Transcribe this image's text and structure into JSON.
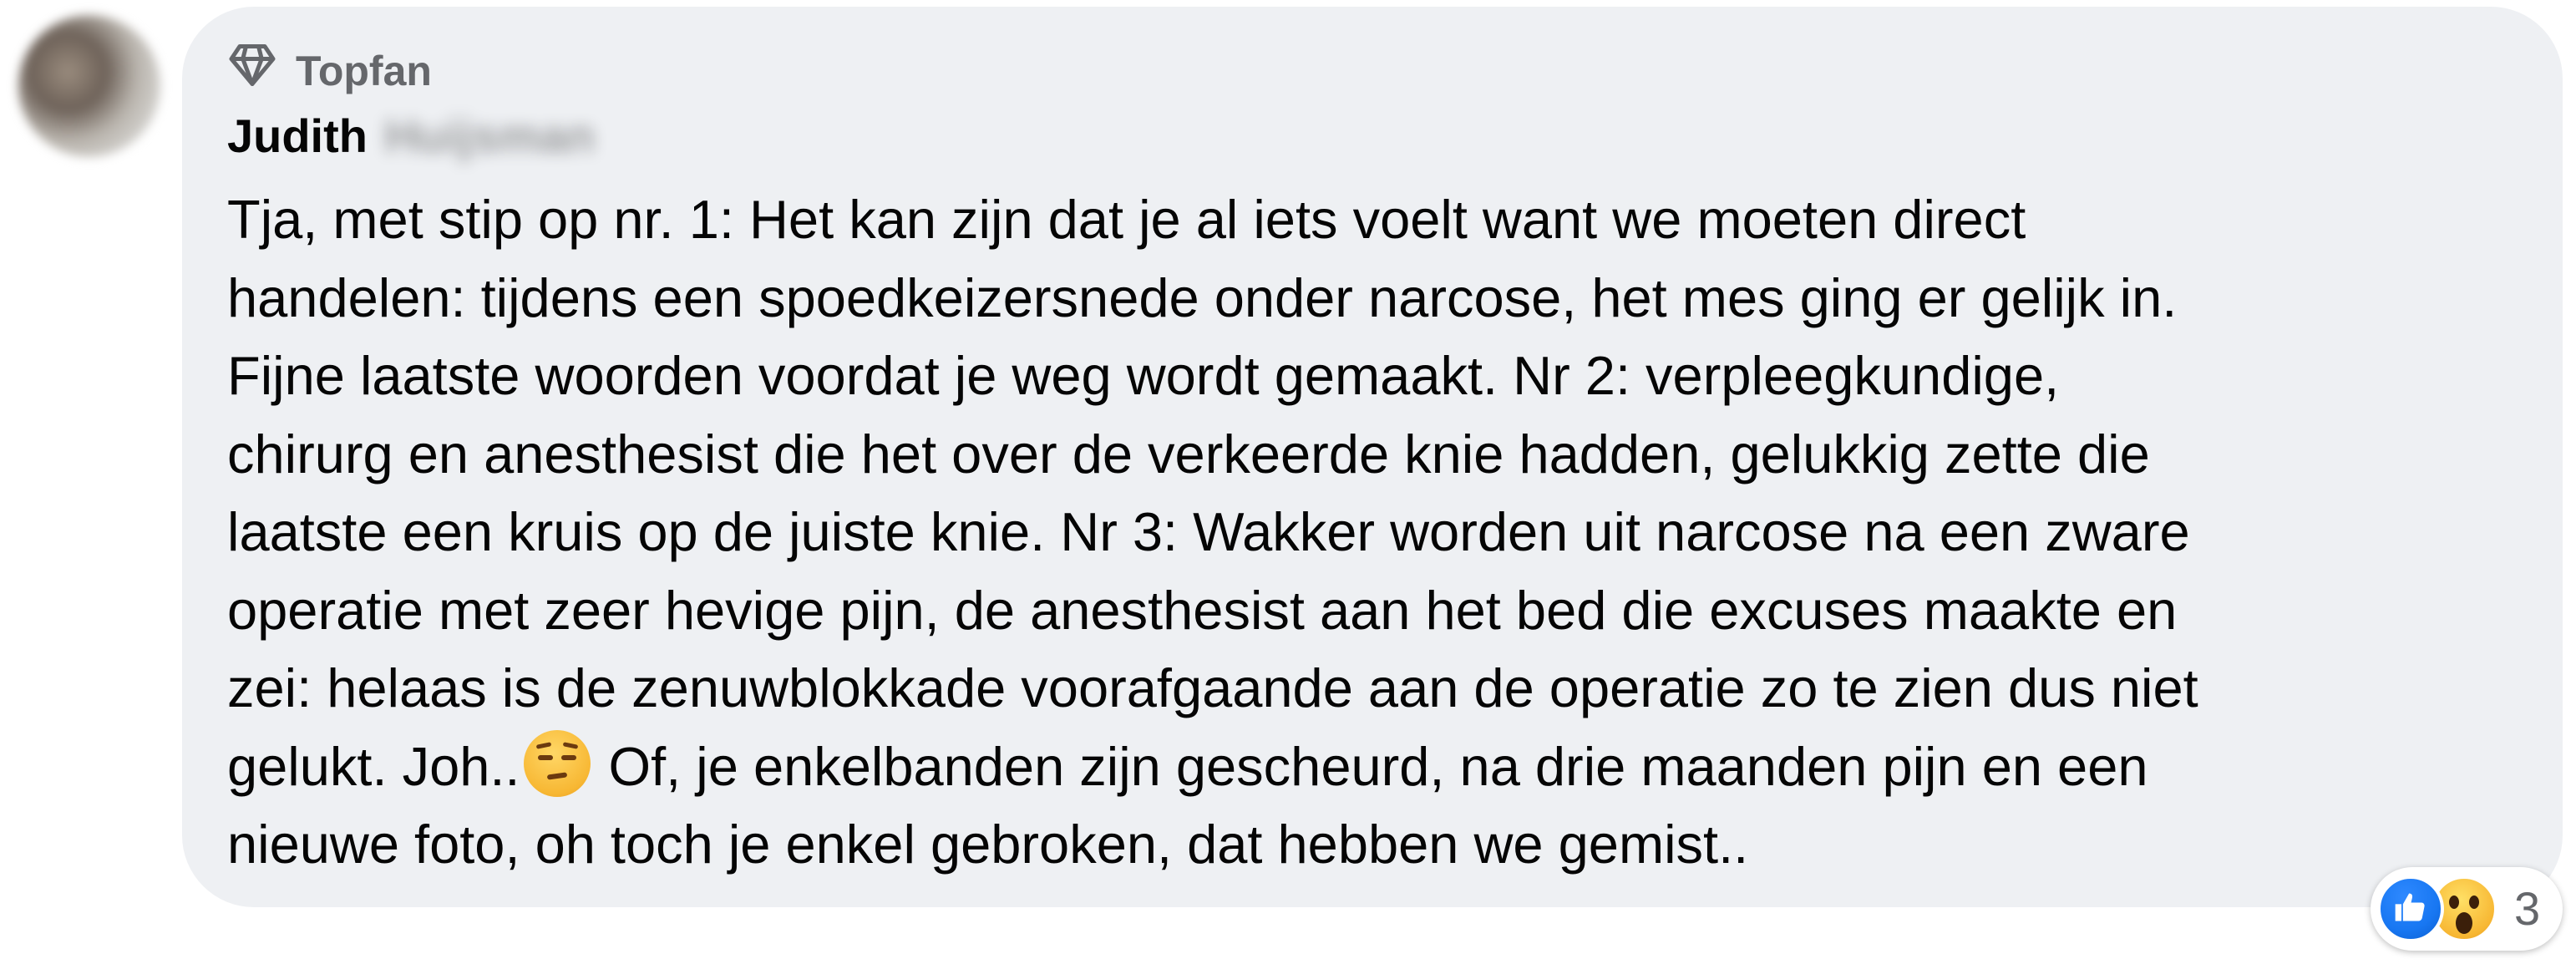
{
  "comment": {
    "badge_label": "Topfan",
    "badge_icon": "diamond-icon",
    "author_first_name": "Judith",
    "author_last_name_blurred": "Huijsman",
    "lines": [
      "Tja, met stip op nr. 1: Het kan zijn dat je al iets voelt want we moeten direct",
      "handelen: tijdens een spoedkeizersnede onder narcose, het mes ging er gelijk in.",
      "Fijne laatste woorden voordat je weg wordt gemaakt. Nr 2: verpleegkundige,",
      "chirurg en anesthesist die het over de verkeerde knie hadden, gelukkig zette die",
      "laatste een kruis op de juiste knie. Nr 3: Wakker worden uit narcose na een zware",
      "operatie met zeer hevige pijn, de anesthesist aan het bed die excuses maakte en",
      "zei: helaas is de zenuwblokkade voorafgaande aan de operatie zo te zien dus niet"
    ],
    "line8_before_emoji": "gelukt. Joh..",
    "line8_emoji": "unamused-face-emoji",
    "line8_after_emoji": " Of, je enkelbanden zijn gescheurd, na drie maanden pijn en een",
    "line9": "nieuwe foto, oh toch je enkel gebroken, dat hebben we gemist.."
  },
  "reactions": {
    "types": [
      "like-icon",
      "wow-icon"
    ],
    "count": "3"
  },
  "colors": {
    "bubble_bg": "#eef0f3",
    "text": "#050505",
    "secondary_text": "#65676b",
    "like_blue": "#1877f2",
    "wow_yellow": "#f7b733"
  }
}
